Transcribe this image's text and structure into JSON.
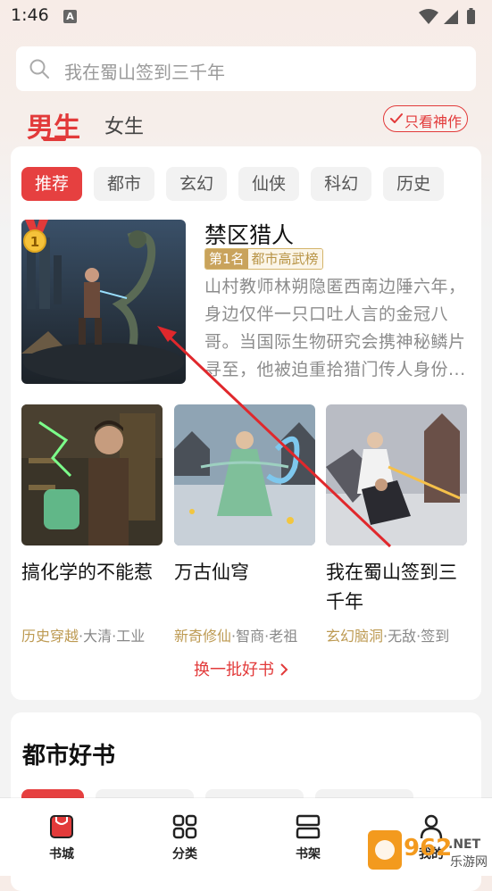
{
  "status_bar": {
    "time": "1:46",
    "notification_letter": "A"
  },
  "search": {
    "placeholder": "我在蜀山签到三千年"
  },
  "gender_tabs": {
    "male": "男生",
    "female": "女生"
  },
  "only_god_label": "只看神作",
  "categories": [
    "推荐",
    "都市",
    "玄幻",
    "仙侠",
    "科幻",
    "历史"
  ],
  "featured": {
    "rank_number": "1",
    "title": "禁区猎人",
    "rank_label": "第1名",
    "rank_list": "都市高武榜",
    "description": "山村教师林朔隐匿西南边陲六年，身边仅伴一只口吐人言的金冠八哥。当国际生物研究会携神秘鳞片寻至，他被迫重拾猎门传人身份..."
  },
  "books": [
    {
      "title": "搞化学的不能惹",
      "tag_highlight": "历史穿越",
      "tags_rest": "·大清·工业"
    },
    {
      "title": "万古仙穹",
      "tag_highlight": "新奇修仙",
      "tags_rest": "·智商·老祖"
    },
    {
      "title": "我在蜀山签到三千年",
      "tag_highlight": "玄幻脑洞",
      "tags_rest": "·无敌·签到"
    }
  ],
  "refresh_label": "换一批好书",
  "section": {
    "title": "都市好书"
  },
  "bottom_nav": [
    {
      "label": "书城",
      "icon": "bookstore-icon"
    },
    {
      "label": "分类",
      "icon": "category-grid-icon"
    },
    {
      "label": "书架",
      "icon": "bookshelf-icon"
    },
    {
      "label": "我的",
      "icon": "profile-icon"
    }
  ],
  "watermark": {
    "number": "962",
    "suffix": ".NET",
    "name": "乐游网"
  },
  "colors": {
    "accent": "#e23a3a",
    "gold": "#c9a35c"
  }
}
